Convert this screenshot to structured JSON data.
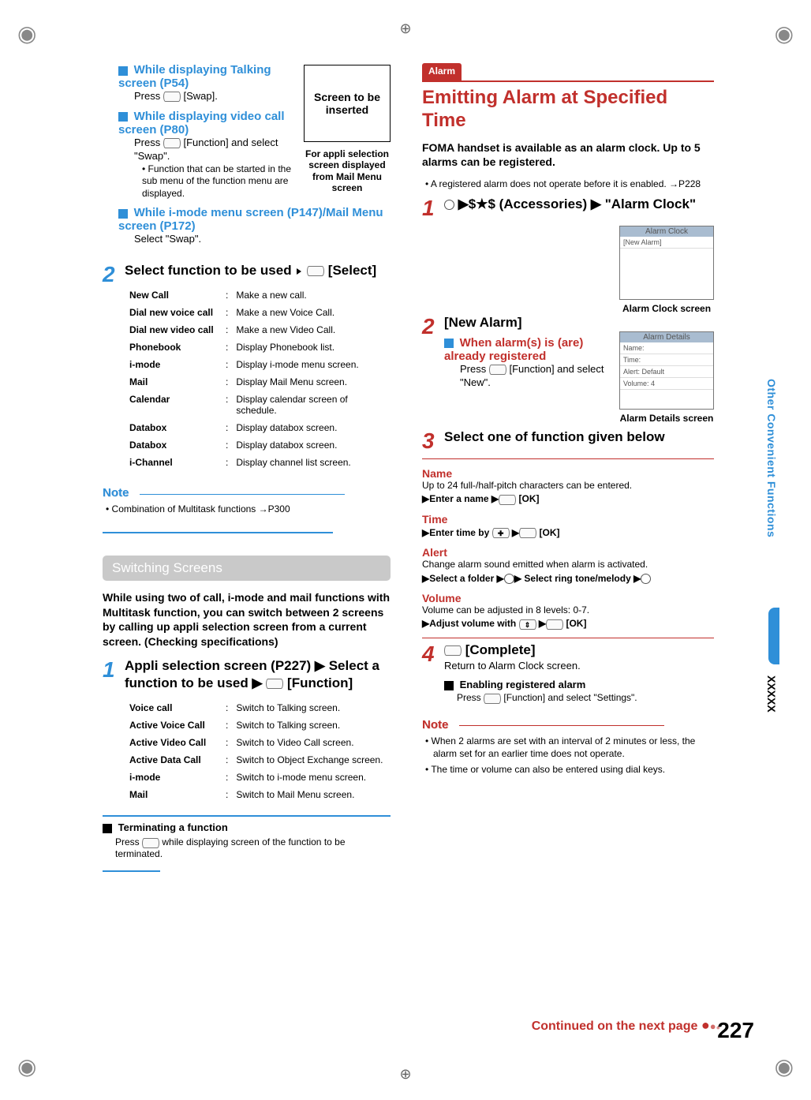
{
  "reg_mark": "◉",
  "cross_mark": "⊕",
  "side_tab": "Other Convenient Functions",
  "side_x": "XXXXX",
  "left": {
    "blk1_title": "While displaying Talking screen (P54)",
    "blk1_body": "Press ",
    "blk1_body2": " [Swap].",
    "blk2_title": "While displaying video call screen (P80)",
    "blk2_body": "Press ",
    "blk2_body2": " [Function] and select \"Swap\".",
    "blk2_note": "Function that can be started in the sub menu of the function menu are displayed.",
    "blk3_title": "While i-mode menu screen (P147)/Mail Menu screen (P172)",
    "blk3_body": "Select \"Swap\".",
    "placeholder_text": "Screen to be inserted",
    "placeholder_cap": "For appli selection screen displayed from Mail Menu screen",
    "step2_num": "2",
    "step2_heading": "Select function to be used ",
    "step2_heading2": " [Select]",
    "func_rows": [
      {
        "l": "New Call",
        "d": "Make a new call."
      },
      {
        "l": "Dial new voice call",
        "d": "Make a new Voice Call."
      },
      {
        "l": "Dial new video call",
        "d": "Make a new Video Call."
      },
      {
        "l": "Phonebook",
        "d": "Display Phonebook list."
      },
      {
        "l": "i-mode",
        "d": "Display i-mode menu screen."
      },
      {
        "l": "Mail",
        "d": "Display Mail Menu screen."
      },
      {
        "l": "Calendar",
        "d": "Display calendar screen of schedule."
      },
      {
        "l": "Databox",
        "d": "Display databox screen."
      },
      {
        "l": "Databox",
        "d": "Display databox screen."
      },
      {
        "l": "i-Channel",
        "d": "Display channel list screen."
      }
    ],
    "note_label": "Note",
    "note_item1": "• Combination of Multitask functions →P300",
    "switch_bar": "Switching Screens",
    "switch_intro": "While using two of call, i-mode and mail functions with Multitask function, you can switch between 2 screens by calling up appli selection screen from a current screen. (Checking specifications)",
    "sw_step1_num": "1",
    "sw_step1_heading": "Appli selection screen (P227) ▶ Select a function to be used ▶",
    "sw_step1_heading2": " [Function]",
    "sw_rows": [
      {
        "l": "Voice call",
        "d": "Switch to Talking screen."
      },
      {
        "l": "Active Voice Call",
        "d": "Switch to Talking screen."
      },
      {
        "l": "Active Video Call",
        "d": "Switch to Video Call screen."
      },
      {
        "l": "Active Data Call",
        "d": "Switch to Object Exchange screen."
      },
      {
        "l": "i-mode",
        "d": "Switch to i-mode menu screen."
      },
      {
        "l": "Mail",
        "d": "Switch to Mail Menu screen."
      }
    ],
    "term_title": "Terminating a function",
    "term_body1": "Press ",
    "term_body2": " while displaying screen of the function to be terminated."
  },
  "right": {
    "tab": "Alarm",
    "heading": "Emitting Alarm at Specified Time",
    "intro_bold": "FOMA handset is available as an alarm clock. Up to 5 alarms can be registered.",
    "intro_note": "A registered alarm does not operate before it is enabled. →P228",
    "step1_num": "1",
    "step1_text": " ▶$★$ (Accessories) ▶ \"Alarm Clock\"",
    "ss1_title": "Alarm Clock",
    "ss1_row": "[New Alarm]",
    "ss1_cap": "Alarm Clock screen",
    "step2_num": "2",
    "step2_text": "[New Alarm]",
    "step2_sub_title": "When alarm(s) is (are) already registered",
    "step2_sub_body1": "Press ",
    "step2_sub_body2": " [Function] and select \"New\".",
    "ss2_title": "Alarm Details",
    "ss2_r1": "Name:",
    "ss2_r2": "Time:",
    "ss2_r3": "Alert: Default",
    "ss2_r4": "Volume: 4",
    "ss2_cap": "Alarm Details screen",
    "step3_num": "3",
    "step3_text": "Select one of function given below",
    "f_name_l": "Name",
    "f_name_d": "Up to 24 full-/half-pitch characters can be entered.",
    "f_name_s": "▶Enter a name ▶",
    "f_name_s2": " [OK]",
    "f_time_l": "Time",
    "f_time_s": "▶Enter time by ",
    "f_time_s2": " ▶",
    "f_time_s3": " [OK]",
    "f_alert_l": "Alert",
    "f_alert_d": "Change alarm sound emitted when alarm is activated.",
    "f_alert_s": "▶Select a folder ▶",
    "f_alert_s2": "▶ Select ring tone/melody ▶",
    "f_vol_l": "Volume",
    "f_vol_d": "Volume can be adjusted in 8 levels: 0-7.",
    "f_vol_s": "▶Adjust volume with ",
    "f_vol_s2": " ▶",
    "f_vol_s3": " [OK]",
    "step4_num": "4",
    "step4_text": " [Complete]",
    "step4_sub": "Return to Alarm Clock screen.",
    "en_title": "Enabling registered alarm",
    "en_body1": "Press ",
    "en_body2": " [Function] and select \"Settings\".",
    "note_label": "Note",
    "note1": "• When 2 alarms are set with an interval of 2 minutes or less, the alarm set for an earlier time does not operate.",
    "note2": "• The time or volume can also be entered using dial keys.",
    "continued": "Continued on the next page"
  },
  "page_num": "227"
}
